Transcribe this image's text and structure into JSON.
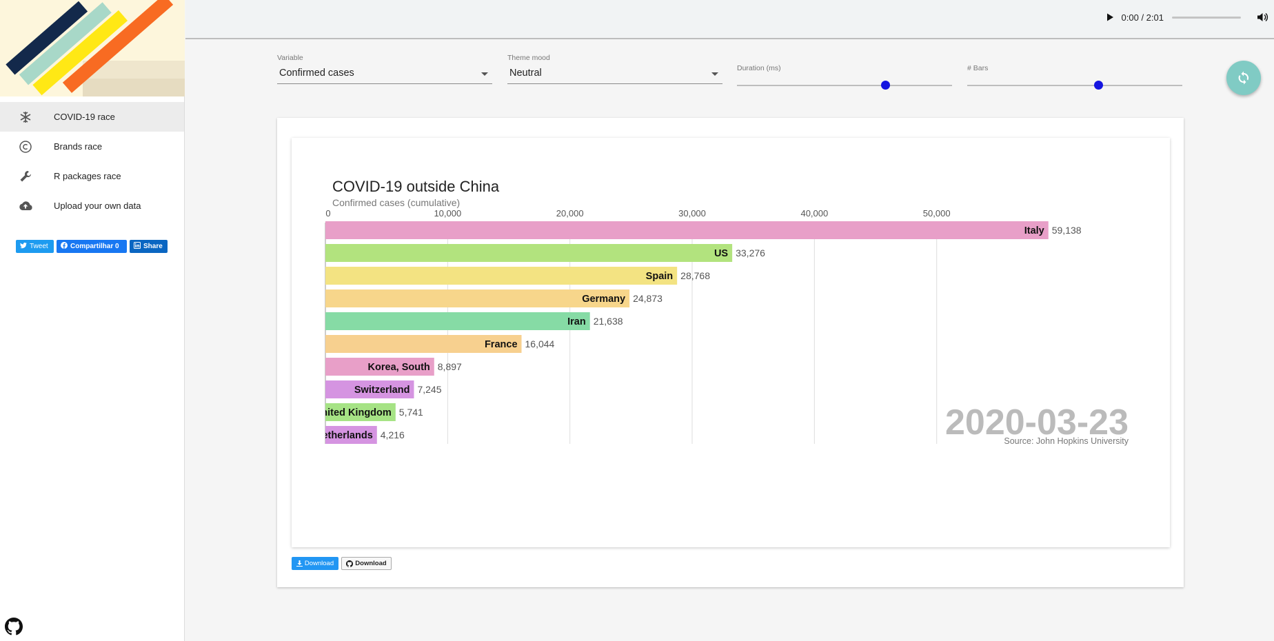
{
  "sidebar": {
    "items": [
      {
        "label": "COVID-19 race",
        "icon": "snowflake-icon",
        "active": true
      },
      {
        "label": "Brands race",
        "icon": "copyright-icon",
        "active": false
      },
      {
        "label": "R packages race",
        "icon": "wrench-icon",
        "active": false
      },
      {
        "label": "Upload your own data",
        "icon": "cloud-upload-icon",
        "active": false
      }
    ],
    "social": {
      "tweet": "Tweet",
      "facebook": "Compartilhar 0",
      "linkedin": "Share"
    }
  },
  "player": {
    "time": "0:00 / 2:01"
  },
  "controls": {
    "variable": {
      "label": "Variable",
      "value": "Confirmed cases"
    },
    "theme": {
      "label": "Theme mood",
      "value": "Neutral"
    },
    "duration": {
      "label": "Duration (ms)",
      "level": 0.69
    },
    "bars": {
      "label": "# Bars",
      "level": 0.61
    }
  },
  "downloads": {
    "download1": "Download",
    "download2": "Download"
  },
  "chart_data": {
    "type": "bar",
    "orientation": "horizontal",
    "title": "COVID-19 outside China",
    "subtitle": "Confirmed cases (cumulative)",
    "date": "2020-03-23",
    "source": "Source: John Hopkins University",
    "ticks": [
      0,
      10000,
      20000,
      30000,
      40000,
      50000
    ],
    "tick_labels": [
      "0",
      "10,000",
      "20,000",
      "30,000",
      "40,000",
      "50,000"
    ],
    "xlim": [
      0,
      62000
    ],
    "categories": [
      "Italy",
      "US",
      "Spain",
      "Germany",
      "Iran",
      "France",
      "Korea, South",
      "Switzerland",
      "United Kingdom",
      "Netherlands"
    ],
    "values": [
      59138,
      33276,
      28768,
      24873,
      21638,
      16044,
      8897,
      7245,
      5741,
      4216
    ],
    "value_labels": [
      "59,138",
      "33,276",
      "28,768",
      "24,873",
      "21,638",
      "16,044",
      "8,897",
      "7,245",
      "5,741",
      "4,216"
    ],
    "colors": [
      "#e89fc8",
      "#b2e37e",
      "#f3e382",
      "#f7d68b",
      "#86dba5",
      "#f7d08f",
      "#e89fc8",
      "#d594e1",
      "#a6e385",
      "#d594e1"
    ],
    "grid": true
  }
}
